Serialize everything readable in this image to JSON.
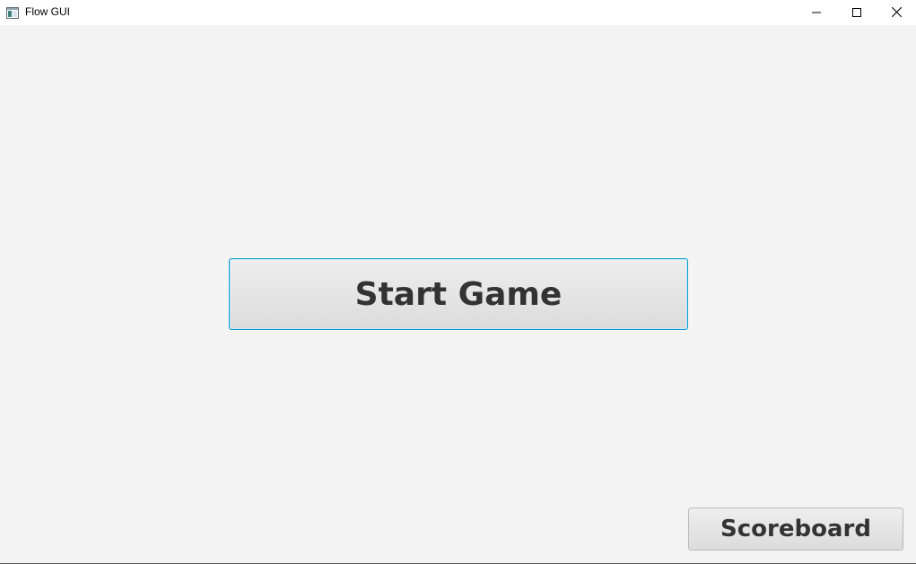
{
  "window": {
    "title": "Flow GUI",
    "app_icon": "window-app-icon",
    "controls": {
      "minimize_icon": "minimize-icon",
      "maximize_icon": "maximize-icon",
      "close_icon": "close-icon"
    }
  },
  "main": {
    "start_button_label": "Start Game",
    "scoreboard_button_label": "Scoreboard"
  },
  "colors": {
    "background": "#f4f4f4",
    "titlebar": "#ffffff",
    "focus_border": "#039ed3",
    "button_text": "#333333"
  }
}
